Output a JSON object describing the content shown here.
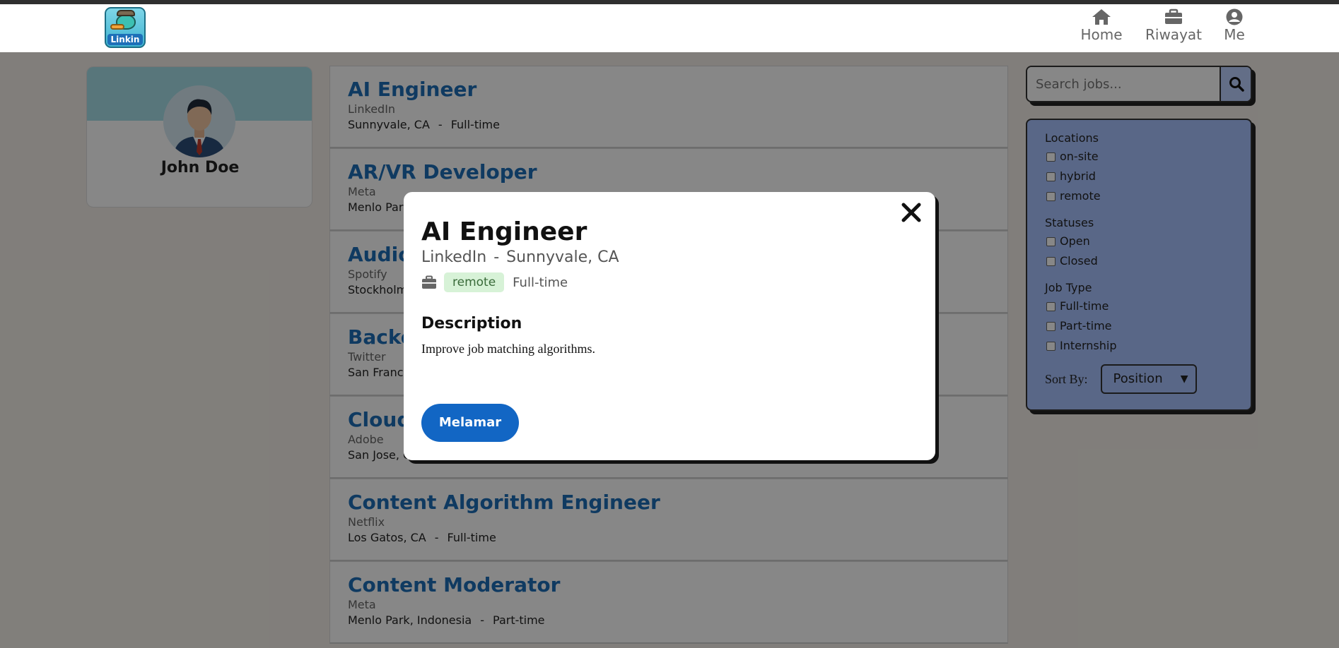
{
  "app": {
    "logo_text": "Linkin"
  },
  "nav": {
    "home_label": "Home",
    "riwayat_label": "Riwayat",
    "me_label": "Me"
  },
  "profile": {
    "name": "John Doe"
  },
  "jobs": [
    {
      "title": "AI Engineer",
      "company": "LinkedIn",
      "location": "Sunnyvale, CA",
      "type": "Full-time"
    },
    {
      "title": "AR/VR Developer",
      "company": "Meta",
      "location": "Menlo Park",
      "type": ""
    },
    {
      "title": "Audio",
      "company": "Spotify",
      "location": "Stockholm",
      "type": ""
    },
    {
      "title": "Backe",
      "company": "Twitter",
      "location": "San Franci",
      "type": ""
    },
    {
      "title": "Cloud",
      "company": "Adobe",
      "location": "San Jose, C",
      "type": ""
    },
    {
      "title": "Content Algorithm Engineer",
      "company": "Netflix",
      "location": "Los Gatos, CA",
      "type": "Full-time"
    },
    {
      "title": "Content Moderator",
      "company": "Meta",
      "location": "Menlo Park, Indonesia",
      "type": "Part-time"
    }
  ],
  "search": {
    "placeholder": "Search jobs..."
  },
  "filters": {
    "locations_title": "Locations",
    "locations": [
      "on-site",
      "hybrid",
      "remote"
    ],
    "statuses_title": "Statuses",
    "statuses": [
      "Open",
      "Closed"
    ],
    "jobtype_title": "Job Type",
    "jobtypes": [
      "Full-time",
      "Part-time",
      "Internship"
    ],
    "sort_label": "Sort By:",
    "sort_value": "Position"
  },
  "modal": {
    "title": "AI Engineer",
    "company": "LinkedIn",
    "location": "Sunnyvale, CA",
    "workplace": "remote",
    "type": "Full-time",
    "description_heading": "Description",
    "description": "Improve job matching algorithms.",
    "apply_label": "Melamar"
  },
  "colors": {
    "accent": "#1266c4",
    "link": "#1d6fb8",
    "filter_bg": "#a9c2ff",
    "tag_bg": "#d7f2d7"
  }
}
